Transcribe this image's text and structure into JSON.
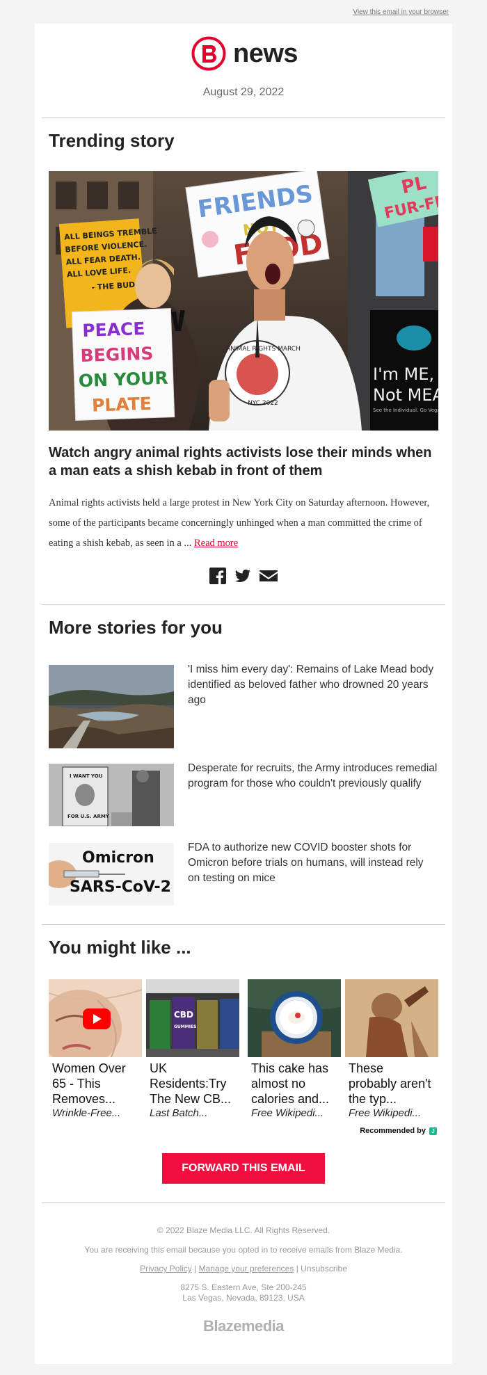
{
  "header": {
    "view_in_browser": "View this email in your browser",
    "logo_text": "news",
    "date": "August 29, 2022"
  },
  "trending": {
    "section_title": "Trending story",
    "headline": "Watch angry animal rights activists lose their minds when a man eats a shish kebab in front of them",
    "summary": "Animal rights activists held a large protest in New York City on Saturday afternoon. However, some of the participants became concerningly unhinged when a man committed the crime of eating a shish kebab, as seen in a ...",
    "read_more": "Read more",
    "sign_left": [
      "ALL BEINGS TREMBLE",
      "BEFORE VIOLENCE.",
      "ALL FEAR DEATH.",
      "ALL LOVE LIFE.",
      "- THE BUDDHA"
    ],
    "sign_peace": [
      "PEACE",
      "BEGINS",
      "ON YOUR",
      "PLATE"
    ],
    "sign_friends": [
      "FRIENDS",
      "NOT",
      "FOOD"
    ],
    "sign_right": [
      "PL",
      "FUR-FR"
    ],
    "sign_meat": [
      "I'm ME,",
      "Not MEAT."
    ],
    "sign_meat_small": "See the Individual. Go Vegan.",
    "shirt_text": "ANIMAL RIGHTS MARCH",
    "shirt_year": "NYC 2022"
  },
  "social": {
    "facebook": "facebook-icon",
    "twitter": "twitter-icon",
    "email": "email-icon"
  },
  "more_stories": {
    "section_title": "More stories for you",
    "items": [
      {
        "title": "'I miss him every day': Remains of Lake Mead body identified as beloved father who drowned 20 years ago"
      },
      {
        "title": "Desperate for recruits, the Army introduces remedial program for those who couldn't previously qualify",
        "poster_text": [
          "I WANT YOU",
          "FOR U.S. ARMY"
        ]
      },
      {
        "title": "FDA to authorize new COVID booster shots for Omicron before trials on humans, will instead rely on testing on mice",
        "img_line1": "Omicron",
        "img_line2": "SARS-CoV-2"
      }
    ]
  },
  "you_might_like": {
    "section_title": "You might like ...",
    "items": [
      {
        "title": "Women Over 65 - This Removes...",
        "source": "Wrinkle-Free..."
      },
      {
        "title": "UK Residents:Try The New CB...",
        "source": "Last Batch...",
        "product_label": "CBD",
        "product_sub": "GUMMIES"
      },
      {
        "title": "This cake has almost no calories and...",
        "source": "Free Wikipedi..."
      },
      {
        "title": "These probably aren't the typ...",
        "source": "Free Wikipedi..."
      }
    ],
    "recommended_by": "Recommended by",
    "recommended_badge": "J"
  },
  "cta": {
    "forward": "FORWARD THIS EMAIL"
  },
  "footer": {
    "copyright": "© 2022 Blaze Media LLC. All Rights Reserved.",
    "opted_in": "You are receiving this email because you opted in to receive emails from Blaze Media.",
    "privacy": "Privacy Policy",
    "sep": "|",
    "manage": "Manage your preferences",
    "unsubscribe": "Unsubscribe",
    "address1": "8275 S. Eastern Ave, Ste 200-245",
    "address2": "Las Vegas, Nevada, 89123, USA",
    "logo": "Blazemedia"
  },
  "colors": {
    "brand_red": "#e4002b",
    "cta_red": "#ef0e3e",
    "rec_green": "#1fb88d"
  }
}
